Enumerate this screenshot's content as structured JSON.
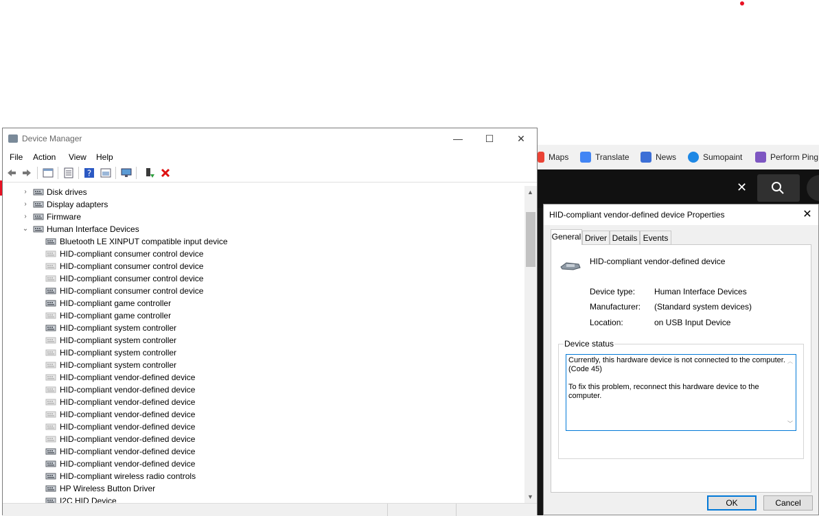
{
  "browser": {
    "bookmarks": [
      {
        "label": "Maps",
        "icon": "maps-icon",
        "color": "#ea4335"
      },
      {
        "label": "Translate",
        "icon": "translate-icon",
        "color": "#4285f4"
      },
      {
        "label": "News",
        "icon": "news-icon",
        "color": "#3c6fd6"
      },
      {
        "label": "Sumopaint",
        "icon": "sumopaint-icon",
        "color": "#1e88e5"
      },
      {
        "label": "Perform Ping",
        "icon": "ping-icon",
        "color": "#7e57c2"
      }
    ]
  },
  "device_manager": {
    "title": "Device Manager",
    "menu": [
      "File",
      "Action",
      "View",
      "Help"
    ],
    "tree": [
      {
        "label": "Disk drives",
        "level": 0,
        "expanded": false,
        "icon": "disk-drive-icon"
      },
      {
        "label": "Display adapters",
        "level": 0,
        "expanded": false,
        "icon": "display-adapter-icon"
      },
      {
        "label": "Firmware",
        "level": 0,
        "expanded": false,
        "icon": "firmware-icon"
      },
      {
        "label": "Human Interface Devices",
        "level": 0,
        "expanded": true,
        "icon": "hid-icon"
      },
      {
        "label": "Bluetooth LE XINPUT compatible input device",
        "level": 1,
        "faded": false
      },
      {
        "label": "HID-compliant consumer control device",
        "level": 1,
        "faded": true
      },
      {
        "label": "HID-compliant consumer control device",
        "level": 1,
        "faded": true
      },
      {
        "label": "HID-compliant consumer control device",
        "level": 1,
        "faded": true
      },
      {
        "label": "HID-compliant consumer control device",
        "level": 1,
        "faded": false
      },
      {
        "label": "HID-compliant game controller",
        "level": 1,
        "faded": false
      },
      {
        "label": "HID-compliant game controller",
        "level": 1,
        "faded": true
      },
      {
        "label": "HID-compliant system controller",
        "level": 1,
        "faded": false
      },
      {
        "label": "HID-compliant system controller",
        "level": 1,
        "faded": true
      },
      {
        "label": "HID-compliant system controller",
        "level": 1,
        "faded": true
      },
      {
        "label": "HID-compliant system controller",
        "level": 1,
        "faded": true
      },
      {
        "label": "HID-compliant vendor-defined device",
        "level": 1,
        "faded": true
      },
      {
        "label": "HID-compliant vendor-defined device",
        "level": 1,
        "faded": true
      },
      {
        "label": "HID-compliant vendor-defined device",
        "level": 1,
        "faded": true
      },
      {
        "label": "HID-compliant vendor-defined device",
        "level": 1,
        "faded": true
      },
      {
        "label": "HID-compliant vendor-defined device",
        "level": 1,
        "faded": true
      },
      {
        "label": "HID-compliant vendor-defined device",
        "level": 1,
        "faded": true
      },
      {
        "label": "HID-compliant vendor-defined device",
        "level": 1,
        "faded": false
      },
      {
        "label": "HID-compliant vendor-defined device",
        "level": 1,
        "faded": false
      },
      {
        "label": "HID-compliant wireless radio controls",
        "level": 1,
        "faded": false
      },
      {
        "label": "HP Wireless Button Driver",
        "level": 1,
        "faded": false
      },
      {
        "label": "I2C HID Device",
        "level": 1,
        "faded": false
      }
    ]
  },
  "properties": {
    "title": "HID-compliant vendor-defined device Properties",
    "tabs": [
      "General",
      "Driver",
      "Details",
      "Events"
    ],
    "device_name": "HID-compliant vendor-defined device",
    "device_type_label": "Device type:",
    "device_type": "Human Interface Devices",
    "manufacturer_label": "Manufacturer:",
    "manufacturer": "(Standard system devices)",
    "location_label": "Location:",
    "location": "on USB Input Device",
    "status_legend": "Device status",
    "status_line1": "Currently, this hardware device is not connected to the computer. (Code 45)",
    "status_line2": "To fix this problem, reconnect this hardware device to the computer.",
    "ok_label": "OK",
    "cancel_label": "Cancel"
  }
}
